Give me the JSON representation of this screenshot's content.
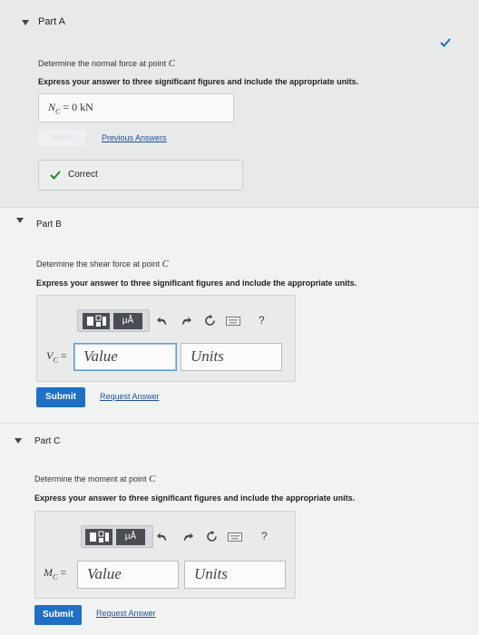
{
  "partA": {
    "title": "Part A",
    "question_prefix": "Determine the normal force at point ",
    "question_point": "C",
    "instruction": "Express your answer to three significant figures and include the appropriate units.",
    "answer_var": "N",
    "answer_sub": "C",
    "answer_value": " =  0 kN",
    "submit_label": "Submit",
    "previous_answers_label": "Previous Answers",
    "correct_label": "Correct"
  },
  "partB": {
    "title": "Part B",
    "question_prefix": "Determine the shear force at point ",
    "question_point": "C",
    "instruction": "Express your answer to three significant figures and include the appropriate units.",
    "var": "V",
    "sub": "C",
    "eq": " =",
    "value_placeholder": "Value",
    "units_placeholder": "Units",
    "submit_label": "Submit",
    "request_answer_label": "Request Answer"
  },
  "partC": {
    "title": "Part C",
    "question_prefix": "Determine the moment at point ",
    "question_point": "C",
    "instruction": "Express your answer to three significant figures and include the appropriate units.",
    "var": "M",
    "sub": "C",
    "eq": " =",
    "value_placeholder": "Value",
    "units_placeholder": "Units",
    "submit_label": "Submit",
    "request_answer_label": "Request Answer"
  },
  "toolbar": {
    "units_symbol": "μÅ",
    "help_symbol": "?"
  },
  "icons": [
    "caret-down-icon",
    "check-icon",
    "templates-icon",
    "units-icon",
    "undo-icon",
    "redo-icon",
    "reset-icon",
    "keyboard-icon",
    "help-icon"
  ],
  "colors": {
    "accent": "#1f6fc4",
    "check": "#2e7d32",
    "link": "#1f4f9c"
  }
}
